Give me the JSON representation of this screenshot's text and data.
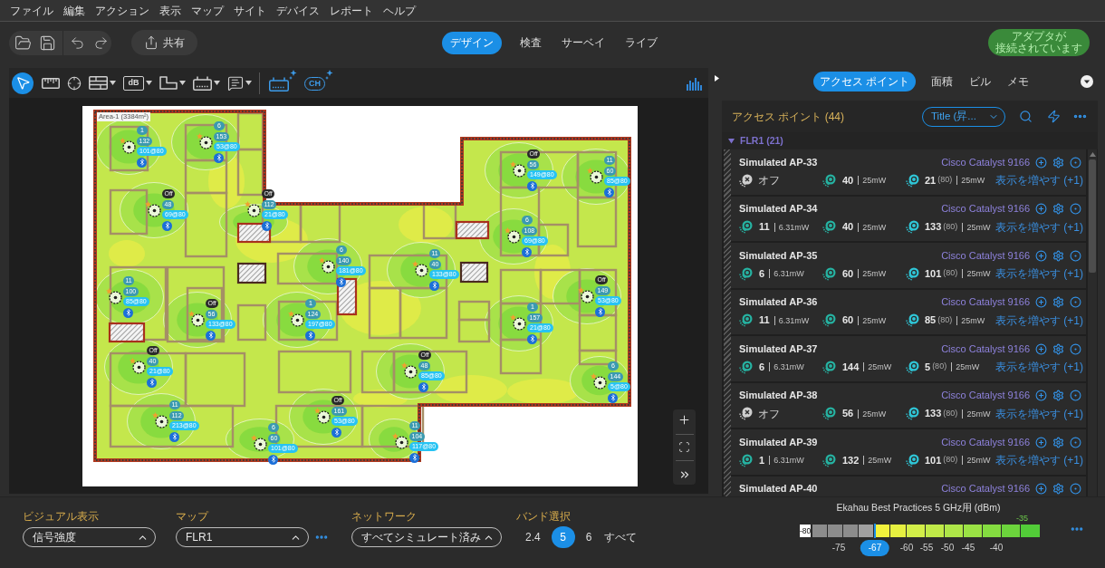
{
  "menu": [
    "ファイル",
    "編集",
    "アクション",
    "表示",
    "マップ",
    "サイト",
    "デバイス",
    "レポート",
    "ヘルプ"
  ],
  "topbar": {
    "share": "共有",
    "modes": [
      {
        "label": "デザイン",
        "selected": true
      },
      {
        "label": "検査",
        "selected": false
      },
      {
        "label": "サーベイ",
        "selected": false
      },
      {
        "label": "ライブ",
        "selected": false
      }
    ],
    "adapter_status": [
      "アダプタが",
      "接続されています"
    ]
  },
  "tools": [
    {
      "kind": "select",
      "selected": true,
      "menu": false
    },
    {
      "kind": "ruler",
      "selected": false,
      "menu": false
    },
    {
      "kind": "target",
      "selected": false,
      "menu": false
    },
    {
      "kind": "wall",
      "selected": false,
      "menu": true
    },
    {
      "kind": "label",
      "text": "dB",
      "selected": false,
      "menu": true
    },
    {
      "kind": "shape",
      "selected": false,
      "menu": true
    },
    {
      "kind": "device",
      "selected": false,
      "menu": true
    },
    {
      "kind": "comment",
      "selected": false,
      "menu": true
    }
  ],
  "auto_tools": [
    {
      "kind": "auto-device"
    },
    {
      "kind": "auto-channel",
      "text": "CH"
    }
  ],
  "map": {
    "area_label": "Area-1 (3384m²)",
    "access_points": [
      {
        "band24": {
          "label": "1",
          "off": false
        },
        "band5": "132",
        "band6": "101@80"
      },
      {
        "band24": {
          "label": "6",
          "off": false
        },
        "band5": "153",
        "band6": "53@80"
      },
      {
        "band24": {
          "label": "Off",
          "off": true
        },
        "band5": "56",
        "band6": "149@80"
      },
      {
        "band24": {
          "label": "11",
          "off": false
        },
        "band5": "60",
        "band6": "85@80"
      },
      {
        "band24": {
          "label": "Off",
          "off": true
        },
        "band5": "48",
        "band6": "69@80"
      },
      {
        "band24": {
          "label": "Off",
          "off": true
        },
        "band5": "112",
        "band6": "21@80"
      },
      {
        "band24": {
          "label": "6",
          "off": false
        },
        "band5": "108",
        "band6": "69@80"
      },
      {
        "band24": {
          "label": "6",
          "off": false
        },
        "band5": "140",
        "band6": "181@80"
      },
      {
        "band24": {
          "label": "11",
          "off": false
        },
        "band5": "40",
        "band6": "133@80"
      },
      {
        "band24": {
          "label": "11",
          "off": false
        },
        "band5": "100",
        "band6": "85@80"
      },
      {
        "band24": {
          "label": "Off",
          "off": true
        },
        "band5": "149",
        "band6": "53@80"
      },
      {
        "band24": {
          "label": "Off",
          "off": true
        },
        "band5": "56",
        "band6": "133@80"
      },
      {
        "band24": {
          "label": "1",
          "off": false
        },
        "band5": "124",
        "band6": "197@80"
      },
      {
        "band24": {
          "label": "1",
          "off": false
        },
        "band5": "157",
        "band6": "21@80"
      },
      {
        "band24": {
          "label": "Off",
          "off": true
        },
        "band5": "40",
        "band6": "21@80"
      },
      {
        "band24": {
          "label": "Off",
          "off": true
        },
        "band5": "48",
        "band6": "85@80"
      },
      {
        "band24": {
          "label": "6",
          "off": false
        },
        "band5": "144",
        "band6": "5@80"
      },
      {
        "band24": {
          "label": "11",
          "off": false
        },
        "band5": "112",
        "band6": "213@80"
      },
      {
        "band24": {
          "label": "Off",
          "off": true
        },
        "band5": "161",
        "band6": "53@80"
      },
      {
        "band24": {
          "label": "6",
          "off": false
        },
        "band5": "60",
        "band6": "101@80"
      },
      {
        "band24": {
          "label": "11",
          "off": false
        },
        "band5": "104",
        "band6": "117@80"
      }
    ]
  },
  "panel": {
    "tabs": [
      {
        "label": "アクセス ポイント",
        "selected": true
      },
      {
        "label": "面積",
        "selected": false
      },
      {
        "label": "ビル",
        "selected": false
      },
      {
        "label": "メモ",
        "selected": false
      }
    ],
    "title": "アクセス ポイント (44)",
    "sort": "Title (昇...",
    "group": {
      "label": "FLR1 (21)",
      "expanded": true
    },
    "rows": [
      {
        "name": "Simulated AP-33",
        "model": "Cisco Catalyst 9166",
        "band24": {
          "off": true,
          "channel": "オフ"
        },
        "band5": {
          "channel": "40",
          "power": "25mW"
        },
        "band6": {
          "channel": "21",
          "width": "(80)",
          "power": "25mW"
        },
        "more": "表示を増やす (+1)"
      },
      {
        "name": "Simulated AP-34",
        "model": "Cisco Catalyst 9166",
        "band24": {
          "off": false,
          "channel": "11",
          "power": "6.31mW"
        },
        "band5": {
          "channel": "40",
          "power": "25mW"
        },
        "band6": {
          "channel": "133",
          "width": "(80)",
          "power": "25mW"
        },
        "more": "表示を増やす (+1)"
      },
      {
        "name": "Simulated AP-35",
        "model": "Cisco Catalyst 9166",
        "band24": {
          "off": false,
          "channel": "6",
          "power": "6.31mW"
        },
        "band5": {
          "channel": "60",
          "power": "25mW"
        },
        "band6": {
          "channel": "101",
          "width": "(80)",
          "power": "25mW"
        },
        "more": "表示を増やす (+1)"
      },
      {
        "name": "Simulated AP-36",
        "model": "Cisco Catalyst 9166",
        "band24": {
          "off": false,
          "channel": "11",
          "power": "6.31mW"
        },
        "band5": {
          "channel": "60",
          "power": "25mW"
        },
        "band6": {
          "channel": "85",
          "width": "(80)",
          "power": "25mW"
        },
        "more": "表示を増やす (+1)"
      },
      {
        "name": "Simulated AP-37",
        "model": "Cisco Catalyst 9166",
        "band24": {
          "off": false,
          "channel": "6",
          "power": "6.31mW"
        },
        "band5": {
          "channel": "144",
          "power": "25mW"
        },
        "band6": {
          "channel": "5",
          "width": "(80)",
          "power": "25mW"
        },
        "more": "表示を増やす (+1)"
      },
      {
        "name": "Simulated AP-38",
        "model": "Cisco Catalyst 9166",
        "band24": {
          "off": true,
          "channel": "オフ"
        },
        "band5": {
          "channel": "56",
          "power": "25mW"
        },
        "band6": {
          "channel": "133",
          "width": "(80)",
          "power": "25mW"
        },
        "more": "表示を増やす (+1)"
      },
      {
        "name": "Simulated AP-39",
        "model": "Cisco Catalyst 9166",
        "band24": {
          "off": false,
          "channel": "1",
          "power": "6.31mW"
        },
        "band5": {
          "channel": "132",
          "power": "25mW"
        },
        "band6": {
          "channel": "101",
          "width": "(80)",
          "power": "25mW"
        },
        "more": "表示を増やす (+1)"
      },
      {
        "name": "Simulated AP-40",
        "model": "Cisco Catalyst 9166"
      }
    ]
  },
  "bottom": {
    "visual": {
      "label": "ビジュアル表示",
      "value": "信号強度"
    },
    "map": {
      "label": "マップ",
      "value": "FLR1"
    },
    "network": {
      "label": "ネットワーク",
      "value": "すべてシミュレート済み"
    },
    "band": {
      "label": "バンド選択",
      "options": [
        {
          "label": "2.4",
          "selected": false
        },
        {
          "label": "5",
          "selected": true
        },
        {
          "label": "6",
          "selected": false
        },
        {
          "label": "すべて",
          "selected": false
        }
      ]
    },
    "legend": {
      "title": "Ekahau Best Practices 5 GHz用 (dBm)",
      "max": "-35",
      "min": "-80",
      "ticks": [
        {
          "label": "-75",
          "selected": false
        },
        {
          "label": "-67",
          "selected": true
        },
        {
          "label": "-60",
          "selected": false
        },
        {
          "label": "-55",
          "selected": false
        },
        {
          "label": "-50",
          "selected": false
        },
        {
          "label": "-45",
          "selected": false
        },
        {
          "label": "-40",
          "selected": false
        }
      ]
    }
  }
}
